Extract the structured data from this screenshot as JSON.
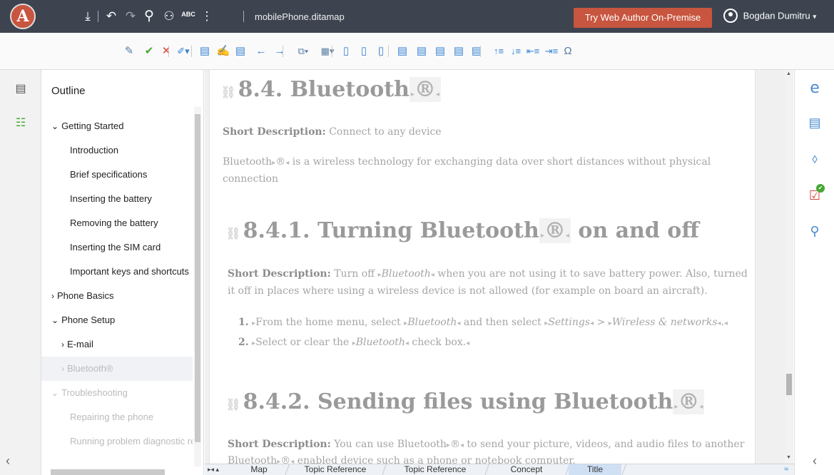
{
  "topbar": {
    "logo": "A",
    "download_icon": "⤓",
    "undo_icon": "↶",
    "redo_icon": "↷",
    "search_icon": "⚲",
    "review_icon": "⚇",
    "spell_icon": "ABC",
    "more_icon": "⋮",
    "file_name": "mobilePhone.ditamap",
    "try_button": "Try Web Author On-Premise",
    "user_name": "Bogdan Dumitru",
    "user_menu_icon": "▾"
  },
  "toolbar": {
    "tools": [
      {
        "name": "track-changes-icon",
        "glyph": "✎",
        "color": "d"
      },
      {
        "name": "accept-change-icon",
        "glyph": "✔",
        "color": "g"
      },
      {
        "name": "reject-change-icon",
        "glyph": "✕",
        "color": "r"
      },
      {
        "name": "highlight-icon",
        "glyph": "✐▾",
        "color": "b"
      },
      {
        "name": "add-comment-icon",
        "glyph": "▤",
        "color": "b"
      },
      {
        "name": "edit-comment-icon",
        "glyph": "✍",
        "color": "b"
      },
      {
        "name": "remove-comment-icon",
        "glyph": "▤",
        "color": "b"
      },
      {
        "name": "previous-change-icon",
        "glyph": "←",
        "color": "b"
      },
      {
        "name": "next-change-icon",
        "glyph": "→",
        "color": "b"
      },
      {
        "name": "copy-menu-icon",
        "glyph": "⧉▾",
        "color": "d"
      },
      {
        "name": "insert-menu-icon",
        "glyph": "▦▾",
        "color": "d"
      },
      {
        "name": "insert-topic-icon",
        "glyph": "▯",
        "color": "b"
      },
      {
        "name": "insert-reference-icon",
        "glyph": "▯",
        "color": "b"
      },
      {
        "name": "insert-keydef-icon",
        "glyph": "▯",
        "color": "b"
      },
      {
        "name": "insert-table-icon",
        "glyph": "▤",
        "color": "b"
      },
      {
        "name": "insert-row-below-icon",
        "glyph": "▤",
        "color": "b"
      },
      {
        "name": "insert-row-above-icon",
        "glyph": "▤",
        "color": "b"
      },
      {
        "name": "insert-column-icon",
        "glyph": "▤",
        "color": "b"
      },
      {
        "name": "delete-row-icon",
        "glyph": "▤",
        "color": "b"
      },
      {
        "name": "move-up-icon",
        "glyph": "↑≡",
        "color": "b"
      },
      {
        "name": "move-down-icon",
        "glyph": "↓≡",
        "color": "b"
      },
      {
        "name": "promote-icon",
        "glyph": "⇤≡",
        "color": "b"
      },
      {
        "name": "demote-icon",
        "glyph": "⇥≡",
        "color": "b"
      },
      {
        "name": "insert-symbol-icon",
        "glyph": "Ω",
        "color": "d"
      }
    ]
  },
  "left_rail": {
    "map_view_icon": "▤",
    "outline_view_icon": "☷"
  },
  "outline": {
    "title": "Outline",
    "items": [
      {
        "label": "Getting Started",
        "toggle": "⌄",
        "indent": 1,
        "state": "normal"
      },
      {
        "label": "Introduction",
        "toggle": "",
        "indent": 2,
        "state": "normal"
      },
      {
        "label": "Brief specifications",
        "toggle": "",
        "indent": 2,
        "state": "normal"
      },
      {
        "label": "Inserting the battery",
        "toggle": "",
        "indent": 2,
        "state": "normal"
      },
      {
        "label": "Removing the battery",
        "toggle": "",
        "indent": 2,
        "state": "normal"
      },
      {
        "label": "Inserting the SIM card",
        "toggle": "",
        "indent": 2,
        "state": "normal"
      },
      {
        "label": "Important keys and shortcuts",
        "toggle": "",
        "indent": 2,
        "state": "normal"
      },
      {
        "label": "Phone Basics",
        "toggle": "›",
        "indent": 1,
        "state": "normal"
      },
      {
        "label": "Phone Setup",
        "toggle": "⌄",
        "indent": 1,
        "state": "normal"
      },
      {
        "label": "E-mail",
        "toggle": "›",
        "indent": 2,
        "state": "normal"
      },
      {
        "label": "Bluetooth®",
        "toggle": "›",
        "indent": 2,
        "state": "selected"
      },
      {
        "label": "Troubleshooting",
        "toggle": "⌄",
        "indent": 1,
        "state": "dim"
      },
      {
        "label": "Repairing the phone",
        "toggle": "",
        "indent": 2,
        "state": "dim"
      },
      {
        "label": "Running problem diagnostic re",
        "toggle": "",
        "indent": 2,
        "state": "dim"
      }
    ],
    "collapse_icon": "‹"
  },
  "document": {
    "h1_number": "8.4.",
    "h1_text": "Bluetooth",
    "reg": "®",
    "short_label": "Short Description:",
    "short1": " Connect to any device",
    "p1a": "Bluetooth",
    "p1b": " is a wireless technology for exchanging data over short distances without physical connection",
    "h2_number": "8.4.1.",
    "h2_text": "Turning Bluetooth",
    "h2_tail": " on and off",
    "short2a": " Turn off ",
    "short2_term": "Bluetooth",
    "short2b": " when you are not using it to save battery power. Also, turned it off in places where using a wireless device is not allowed (for example on board an aircraft).",
    "step1_num": "1.",
    "step1a": "From the home menu, select ",
    "step1_term1": "Bluetooth",
    "step1b": " and then select ",
    "step1_term2": "Settings",
    "step1c": " > ",
    "step1_term3": "Wireless & networks",
    "step1d": ".",
    "step2_num": "2.",
    "step2a": "Select or clear the ",
    "step2_term": "Bluetooth",
    "step2b": " check box.",
    "h3_number": "8.4.2.",
    "h3_text": "Sending files using Bluetooth",
    "short3": " You can use Bluetooth",
    "short3b": " to send your picture, videos, and audio files to another",
    "p3": "Bluetooth",
    "p3b": " enabled device such as a phone or notebook computer."
  },
  "right_rail": {
    "edge_icon": "e",
    "comments_icon": "▤",
    "tags_icon": "⬨",
    "validation_icon": "☑",
    "find_icon": "⚲",
    "collapse_icon": "‹"
  },
  "breadcrumb": {
    "nav_icon": "▸◂ ▴",
    "items": [
      "Map",
      "Topic Reference",
      "Topic Reference",
      "Concept",
      "Title"
    ],
    "active_index": 4,
    "expand_icon": "≈"
  },
  "colors": {
    "topbar_bg": "#3d4450",
    "try_button_bg": "#c8553f",
    "accent_blue": "#3a86d4",
    "accept_green": "#44a832",
    "reject_red": "#d9453b"
  }
}
